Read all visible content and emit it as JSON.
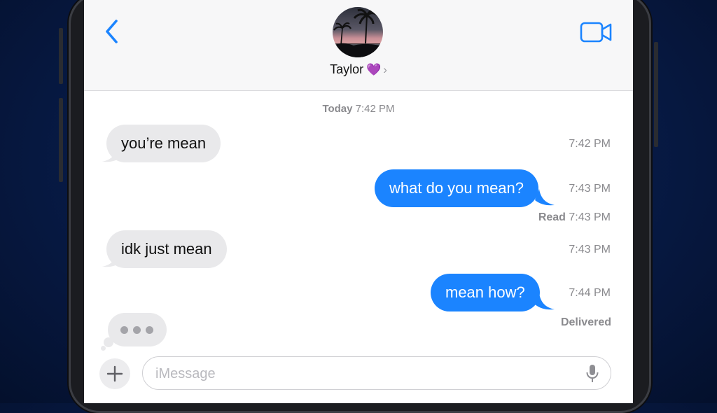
{
  "header": {
    "contact_name": "Taylor",
    "contact_emoji": "💜",
    "contact_chevron": "›",
    "back_icon": "chevron-left-icon",
    "video_icon": "video-camera-icon",
    "accent_color": "#1b84ff"
  },
  "thread": {
    "date_day": "Today",
    "date_time": "7:42 PM",
    "messages": [
      {
        "direction": "incoming",
        "text": "you’re mean",
        "time": "7:42 PM"
      },
      {
        "direction": "outgoing",
        "text": "what do you mean?",
        "time": "7:43 PM",
        "status_label": "Read",
        "status_time": "7:43 PM"
      },
      {
        "direction": "incoming",
        "text": "idk just mean",
        "time": "7:43 PM"
      },
      {
        "direction": "outgoing",
        "text": "mean how?",
        "time": "7:44 PM",
        "status_label": "Delivered"
      }
    ],
    "typing_indicator": "•••"
  },
  "composer": {
    "placeholder": "iMessage",
    "add_icon": "plus-icon",
    "mic_icon": "microphone-icon"
  }
}
